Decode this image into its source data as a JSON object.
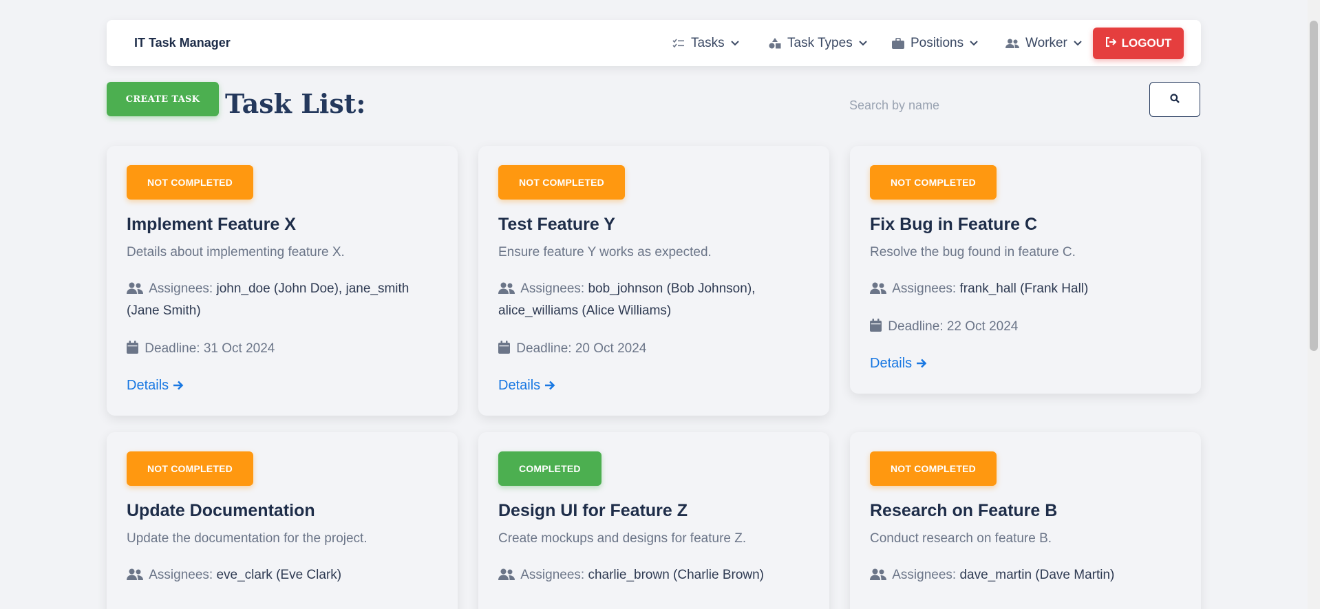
{
  "navbar": {
    "brand": "IT Task Manager",
    "items": [
      {
        "label": "Tasks",
        "icon": "tasks-checklist-icon"
      },
      {
        "label": "Task Types",
        "icon": "shapes-icon"
      },
      {
        "label": "Positions",
        "icon": "briefcase-icon"
      },
      {
        "label": "Worker",
        "icon": "users-icon"
      }
    ],
    "logout_label": "LOGOUT"
  },
  "toolbar": {
    "create_label": "CREATE TASK",
    "title": "Task List:",
    "search_placeholder": "Search by name"
  },
  "tasks": [
    {
      "status": "NOT COMPLETED",
      "title": "Implement Feature X",
      "description": "Details about implementing feature X.",
      "assignees_label": "Assignees:",
      "assignees": "john_doe (John Doe), jane_smith (Jane Smith)",
      "deadline": "Deadline: 31 Oct 2024",
      "details_label": "Details"
    },
    {
      "status": "NOT COMPLETED",
      "title": "Test Feature Y",
      "description": "Ensure feature Y works as expected.",
      "assignees_label": "Assignees:",
      "assignees": "bob_johnson (Bob Johnson), alice_williams (Alice Williams)",
      "deadline": "Deadline: 20 Oct 2024",
      "details_label": "Details"
    },
    {
      "status": "NOT COMPLETED",
      "title": "Fix Bug in Feature C",
      "description": "Resolve the bug found in feature C.",
      "assignees_label": "Assignees:",
      "assignees": "frank_hall (Frank Hall)",
      "deadline": "Deadline: 22 Oct 2024",
      "details_label": "Details"
    },
    {
      "status": "NOT COMPLETED",
      "title": "Update Documentation",
      "description": "Update the documentation for the project.",
      "assignees_label": "Assignees:",
      "assignees": "eve_clark (Eve Clark)"
    },
    {
      "status": "COMPLETED",
      "title": "Design UI for Feature Z",
      "description": "Create mockups and designs for feature Z.",
      "assignees_label": "Assignees:",
      "assignees": "charlie_brown (Charlie Brown)"
    },
    {
      "status": "NOT COMPLETED",
      "title": "Research on Feature B",
      "description": "Conduct research on feature B.",
      "assignees_label": "Assignees:",
      "assignees": "dave_martin (Dave Martin)"
    }
  ],
  "colors": {
    "not_completed": "#ff9810",
    "completed": "#4caf50",
    "logout": "#e53e3e",
    "link": "#1877e2",
    "heading": "#1e2d49"
  }
}
